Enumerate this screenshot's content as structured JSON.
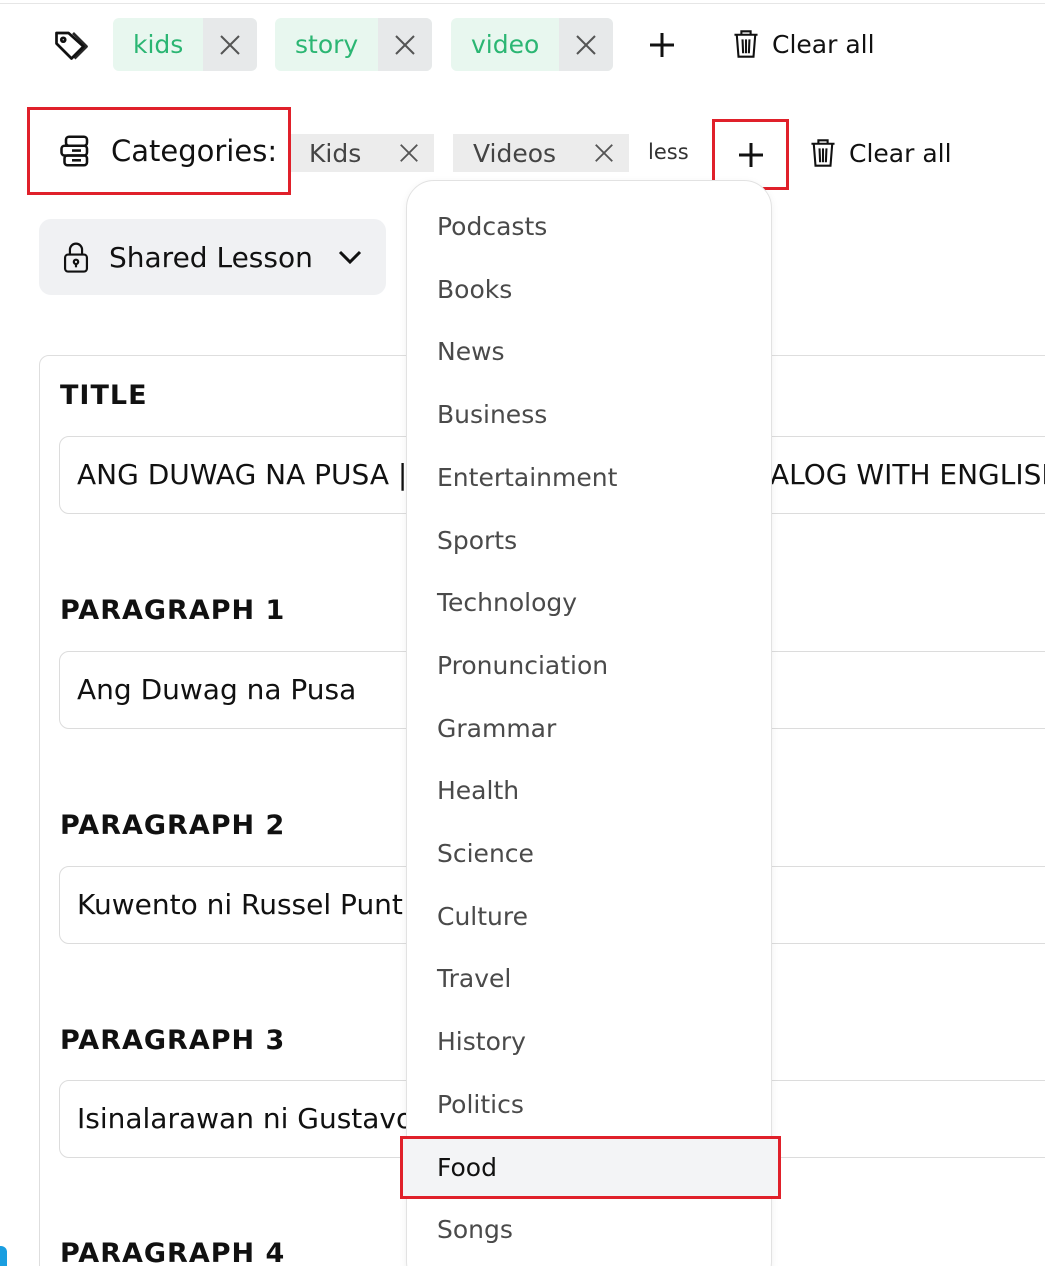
{
  "tags": {
    "items": [
      {
        "label": "kids"
      },
      {
        "label": "story"
      },
      {
        "label": "video"
      }
    ],
    "clear_label": "Clear all"
  },
  "categories": {
    "label": "Categories:",
    "items": [
      {
        "label": "Kids"
      },
      {
        "label": "Videos"
      }
    ],
    "less_label": "less",
    "clear_label": "Clear all"
  },
  "shared": {
    "label": "Shared Lesson"
  },
  "form": {
    "title_label": "TITLE",
    "title_value": "ANG DUWAG NA PUSA |",
    "title_value_tail": "ALOG WITH ENGLISH",
    "p1_label": "PARAGRAPH 1",
    "p1_value": "Ang Duwag na Pusa",
    "p2_label": "PARAGRAPH 2",
    "p2_value": "Kuwento ni Russel Punt",
    "p3_label": "PARAGRAPH 3",
    "p3_value": "Isinalarawan ni Gustavo",
    "p4_label": "PARAGRAPH 4"
  },
  "dropdown": {
    "options": [
      "Podcasts",
      "Books",
      "News",
      "Business",
      "Entertainment",
      "Sports",
      "Technology",
      "Pronunciation",
      "Grammar",
      "Health",
      "Science",
      "Culture",
      "Travel",
      "History",
      "Politics",
      "Food",
      "Songs"
    ],
    "highlighted": "Food"
  },
  "colors": {
    "accent_green": "#2bb673",
    "chip_green_bg": "#e8f7ef",
    "highlight_red": "#e0202a"
  }
}
